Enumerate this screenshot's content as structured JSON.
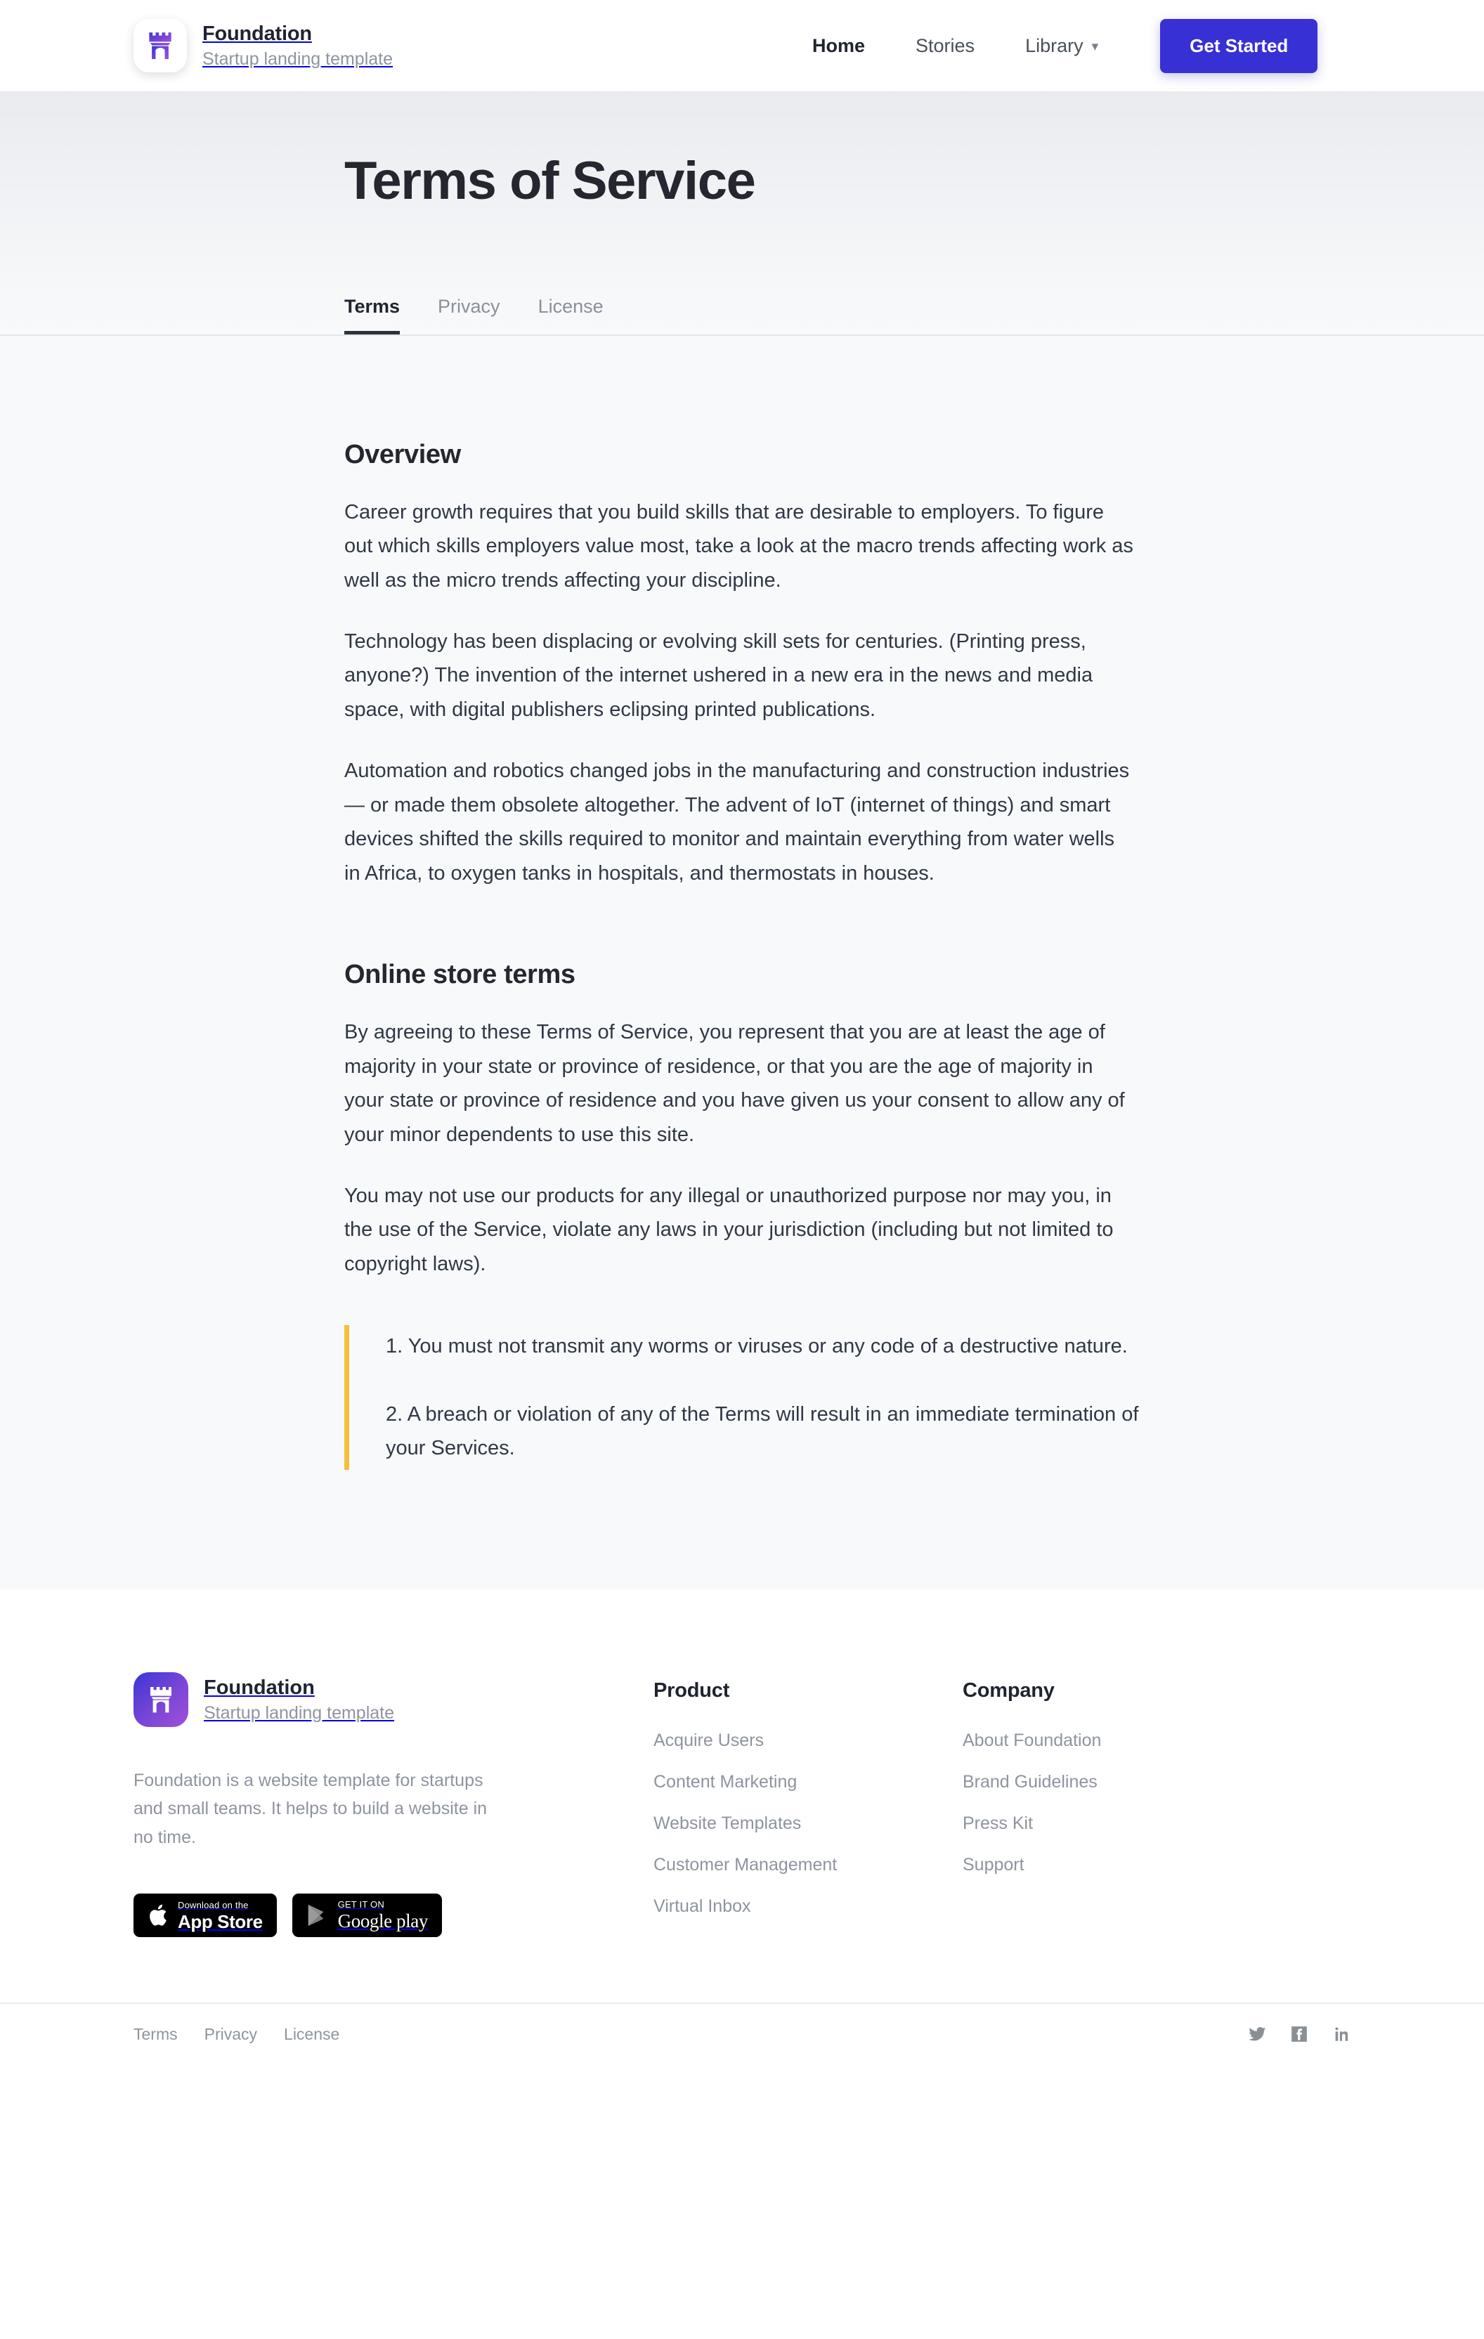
{
  "brand": {
    "name": "Foundation",
    "tagline": "Startup landing template",
    "logo_icon": "castle-gate-icon",
    "gradient_from": "#3b36d6",
    "gradient_to": "#a24fd8"
  },
  "header": {
    "nav": [
      {
        "label": "Home",
        "active": true,
        "caret": false
      },
      {
        "label": "Stories",
        "active": false,
        "caret": false
      },
      {
        "label": "Library",
        "active": false,
        "caret": true,
        "caret_icon": "chevron-down-icon"
      }
    ],
    "cta_label": "Get Started",
    "cta_color": "#3730d4"
  },
  "hero": {
    "title": "Terms of Service",
    "tabs": [
      {
        "label": "Terms",
        "active": true
      },
      {
        "label": "Privacy",
        "active": false
      },
      {
        "label": "License",
        "active": false
      }
    ]
  },
  "main": {
    "sections": [
      {
        "heading": "Overview",
        "paragraphs": [
          "Career growth requires that you build skills that are desirable to employers. To figure out which skills employers value most, take a look at the macro trends affecting work as well as the micro trends affecting your discipline.",
          "Technology has been displacing or evolving skill sets for centuries. (Printing press, anyone?) The invention of the internet ushered in a new era in the news and media space, with digital publishers eclipsing printed publications.",
          "Automation and robotics changed jobs in the manufacturing and construction industries — or made them obsolete altogether. The advent of IoT (internet of things) and smart devices shifted the skills required to monitor and maintain everything from water wells in Africa, to oxygen tanks in hospitals, and thermostats in houses."
        ]
      },
      {
        "heading": "Online store terms",
        "paragraphs": [
          "By agreeing to these Terms of Service, you represent that you are at least the age of majority in your state or province of residence, or that you are the age of majority in your state or province of residence and you have given us your consent to allow any of your minor dependents to use this site.",
          "You may not use our products for any illegal or unauthorized purpose nor may you, in the use of the Service, violate any laws in your jurisdiction (including but not limited to copyright laws)."
        ],
        "quote": {
          "accent_color": "#f5bf3a",
          "items": [
            "1. You must not transmit any worms or viruses or any code of a destructive nature.",
            "2. A breach or violation of any of the Terms will result in an immediate termination of your Services."
          ]
        }
      }
    ]
  },
  "footer": {
    "description": "Foundation is a website template for startups and small teams. It helps to build a website in no time.",
    "badges": [
      {
        "icon": "apple-icon",
        "small": "Download on the",
        "big": "App Store"
      },
      {
        "icon": "google-play-icon",
        "small": "GET IT ON",
        "big": "Google play"
      }
    ],
    "columns": [
      {
        "heading": "Product",
        "links": [
          "Acquire Users",
          "Content Marketing",
          "Website Templates",
          "Customer Management",
          "Virtual Inbox"
        ]
      },
      {
        "heading": "Company",
        "links": [
          "About Foundation",
          "Brand Guidelines",
          "Press Kit",
          "Support"
        ]
      }
    ],
    "legal": [
      "Terms",
      "Privacy",
      "License"
    ],
    "socials": [
      "twitter-icon",
      "facebook-icon",
      "linkedin-icon"
    ]
  }
}
